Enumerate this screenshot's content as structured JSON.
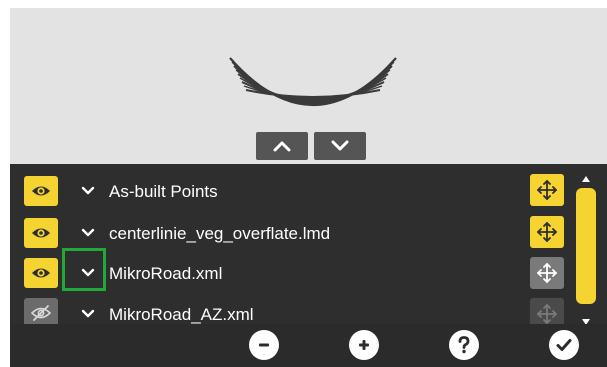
{
  "preview": {
    "scroll_up_icon": "chevron-up-icon",
    "scroll_down_icon": "chevron-down-icon"
  },
  "layers": [
    {
      "name": "As-built Points",
      "visible": true,
      "expanded": true,
      "move_state": "enabled"
    },
    {
      "name": "centerlinie_veg_overflate.lmd",
      "visible": true,
      "expanded": true,
      "move_state": "enabled"
    },
    {
      "name": "MikroRoad.xml",
      "visible": true,
      "expanded": true,
      "highlighted": true,
      "move_state": "inactive"
    },
    {
      "name": "MikroRoad_AZ.xml",
      "visible": false,
      "expanded": true,
      "move_state": "disabled"
    }
  ],
  "toolbar": {
    "buttons": [
      "minus-circle-icon",
      "plus-circle-icon",
      "question-circle-icon",
      "check-circle-icon"
    ]
  },
  "colors": {
    "accent": "#f5d431",
    "panel": "#2e2e2e",
    "preview_bg": "#e3e3e3",
    "highlight": "#22a838"
  }
}
